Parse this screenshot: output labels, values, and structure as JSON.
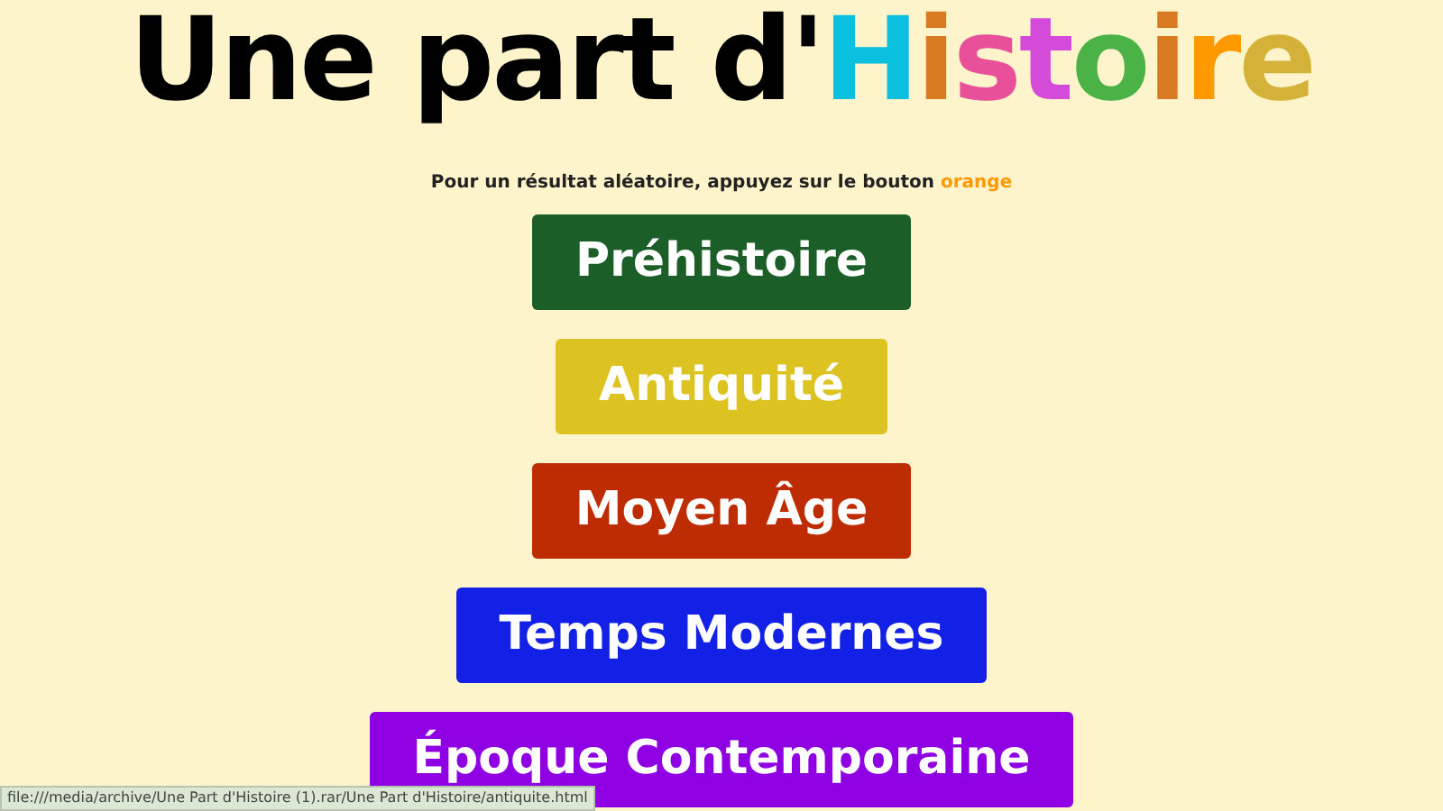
{
  "title": [
    {
      "text": "Une part d'",
      "color": "#000000"
    },
    {
      "text": "H",
      "color": "#0bbfdf"
    },
    {
      "text": "i",
      "color": "#d87a22"
    },
    {
      "text": "s",
      "color": "#e9509a"
    },
    {
      "text": "t",
      "color": "#d54bd9"
    },
    {
      "text": "o",
      "color": "#4bb248"
    },
    {
      "text": "i",
      "color": "#d87a22"
    },
    {
      "text": "r",
      "color": "#ff9900"
    },
    {
      "text": "e",
      "color": "#d4b23a"
    }
  ],
  "instruction": {
    "text": "Pour un résultat aléatoire, appuyez sur le bouton",
    "highlight": "orange"
  },
  "periods": [
    {
      "label": "Préhistoire",
      "color": "#1b5e28"
    },
    {
      "label": "Antiquité",
      "color": "#dcc322"
    },
    {
      "label": "Moyen Âge",
      "color": "#be2c03"
    },
    {
      "label": "Temps Modernes",
      "color": "#1320e6"
    },
    {
      "label": "Époque Contemporaine",
      "color": "#8f00e3"
    }
  ],
  "status_bar": {
    "url": "file:///media/archive/Une Part d'Histoire (1).rar/Une Part d'Histoire/antiquite.html"
  }
}
